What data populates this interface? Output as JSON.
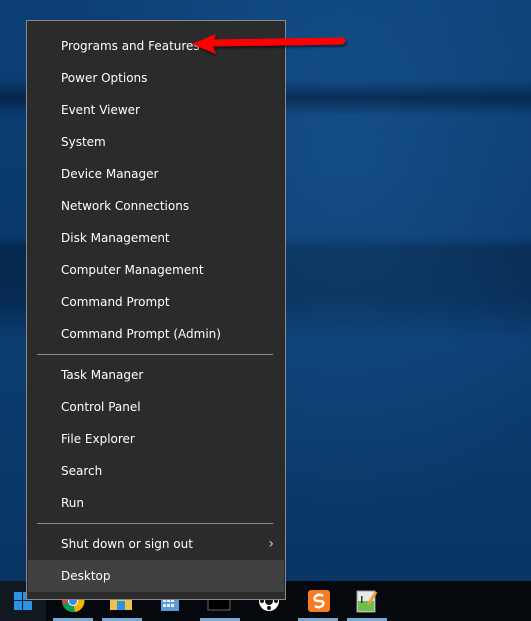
{
  "menu": {
    "group1": [
      {
        "label": "Programs and Features"
      },
      {
        "label": "Power Options"
      },
      {
        "label": "Event Viewer"
      },
      {
        "label": "System"
      },
      {
        "label": "Device Manager"
      },
      {
        "label": "Network Connections"
      },
      {
        "label": "Disk Management"
      },
      {
        "label": "Computer Management"
      },
      {
        "label": "Command Prompt"
      },
      {
        "label": "Command Prompt (Admin)"
      }
    ],
    "group2": [
      {
        "label": "Task Manager"
      },
      {
        "label": "Control Panel"
      },
      {
        "label": "File Explorer"
      },
      {
        "label": "Search"
      },
      {
        "label": "Run"
      }
    ],
    "group3": [
      {
        "label": "Shut down or sign out",
        "submenu_icon": "chevron-right-icon"
      },
      {
        "label": "Desktop",
        "highlighted": true
      }
    ]
  },
  "annotation": {
    "type": "arrow",
    "color": "#ff0000",
    "points_to": "Programs and Features"
  },
  "taskbar": {
    "start_icon": "windows-logo-icon",
    "pinned": [
      "chrome-icon",
      "file-explorer-icon",
      "calculator-icon",
      "media-icon",
      "app-icon",
      "orange-app-icon",
      "notepad-icon"
    ]
  },
  "colors": {
    "menu_bg": "#2b2b2b",
    "menu_border": "#8a8a8a",
    "highlight": "#414141",
    "taskbar_bg": "#05080c",
    "accent": "#7aa8d6"
  }
}
